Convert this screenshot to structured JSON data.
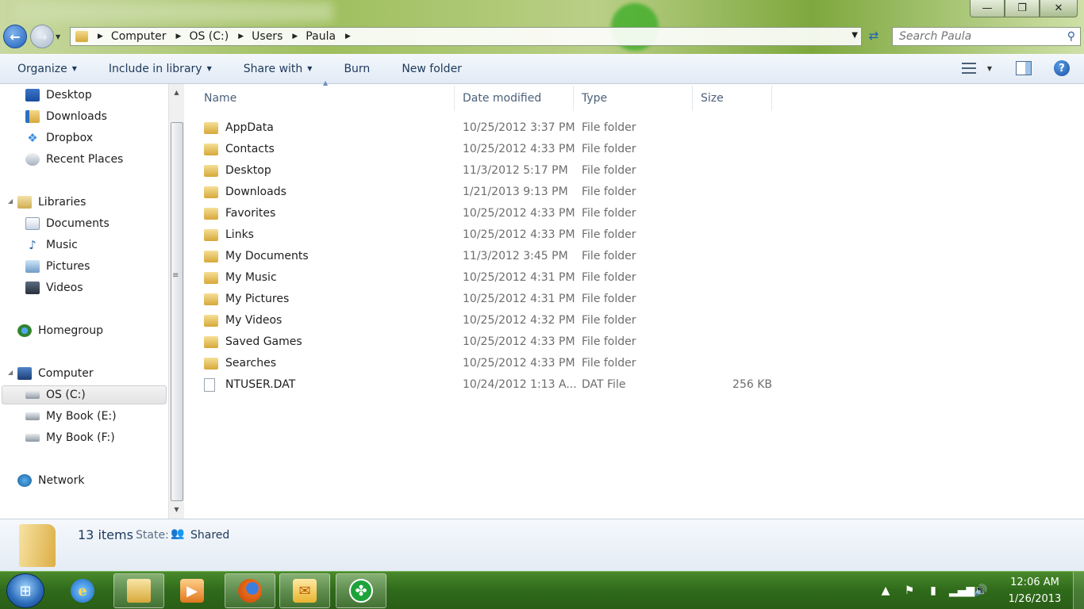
{
  "window": {
    "minimize_glyph": "—",
    "maximize_glyph": "❐",
    "close_glyph": "✕"
  },
  "address": {
    "crumbs": [
      "Computer",
      "OS (C:)",
      "Users",
      "Paula"
    ],
    "search_placeholder": "Search Paula"
  },
  "toolbar": {
    "organize": "Organize",
    "include_in_library": "Include in library",
    "share_with": "Share with",
    "burn": "Burn",
    "new_folder": "New folder"
  },
  "nav": {
    "items": [
      {
        "label": "Desktop",
        "icon": "desktop-icon"
      },
      {
        "label": "Downloads",
        "icon": "downloads-folder-icon"
      },
      {
        "label": "Dropbox",
        "icon": "dropbox-icon"
      },
      {
        "label": "Recent Places",
        "icon": "recent-places-icon"
      },
      {
        "label": "Libraries",
        "icon": "libraries-icon"
      },
      {
        "label": "Documents",
        "icon": "documents-icon"
      },
      {
        "label": "Music",
        "icon": "music-icon"
      },
      {
        "label": "Pictures",
        "icon": "pictures-icon"
      },
      {
        "label": "Videos",
        "icon": "videos-icon"
      },
      {
        "label": "Homegroup",
        "icon": "homegroup-icon"
      },
      {
        "label": "Computer",
        "icon": "computer-icon"
      },
      {
        "label": "OS (C:)",
        "icon": "drive-icon"
      },
      {
        "label": "My Book (E:)",
        "icon": "drive-icon"
      },
      {
        "label": "My Book (F:)",
        "icon": "drive-icon"
      },
      {
        "label": "Network",
        "icon": "network-icon"
      }
    ],
    "selected": "OS (C:)"
  },
  "columns": {
    "name": "Name",
    "date": "Date modified",
    "type": "Type",
    "size": "Size"
  },
  "files": [
    {
      "name": "AppData",
      "date": "10/25/2012 3:37 PM",
      "type": "File folder",
      "size": ""
    },
    {
      "name": "Contacts",
      "date": "10/25/2012 4:33 PM",
      "type": "File folder",
      "size": ""
    },
    {
      "name": "Desktop",
      "date": "11/3/2012 5:17 PM",
      "type": "File folder",
      "size": ""
    },
    {
      "name": "Downloads",
      "date": "1/21/2013 9:13 PM",
      "type": "File folder",
      "size": ""
    },
    {
      "name": "Favorites",
      "date": "10/25/2012 4:33 PM",
      "type": "File folder",
      "size": ""
    },
    {
      "name": "Links",
      "date": "10/25/2012 4:33 PM",
      "type": "File folder",
      "size": ""
    },
    {
      "name": "My Documents",
      "date": "11/3/2012 3:45 PM",
      "type": "File folder",
      "size": ""
    },
    {
      "name": "My Music",
      "date": "10/25/2012 4:31 PM",
      "type": "File folder",
      "size": ""
    },
    {
      "name": "My Pictures",
      "date": "10/25/2012 4:31 PM",
      "type": "File folder",
      "size": ""
    },
    {
      "name": "My Videos",
      "date": "10/25/2012 4:32 PM",
      "type": "File folder",
      "size": ""
    },
    {
      "name": "Saved Games",
      "date": "10/25/2012 4:33 PM",
      "type": "File folder",
      "size": ""
    },
    {
      "name": "Searches",
      "date": "10/25/2012 4:33 PM",
      "type": "File folder",
      "size": ""
    },
    {
      "name": "NTUSER.DAT",
      "date": "10/24/2012 1:13 A...",
      "type": "DAT File",
      "size": "256 KB"
    }
  ],
  "details": {
    "count": "13 items",
    "state_label": "State:",
    "state_value": "Shared"
  },
  "taskbar": {
    "apps": [
      "internet-explorer-icon",
      "windows-explorer-icon",
      "media-player-icon",
      "firefox-icon",
      "outlook-icon",
      "app-icon"
    ],
    "time": "12:06 AM",
    "date": "1/26/2013"
  },
  "colors": {
    "accent": "#1e395b",
    "taskbar": "#2f6a1a"
  }
}
